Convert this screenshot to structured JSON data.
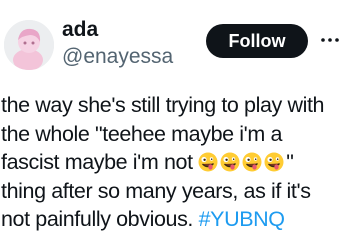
{
  "author": {
    "display_name": "ada",
    "handle": "@enayessa",
    "avatar_icon": "pink-character-avatar-icon"
  },
  "follow_button_label": "Follow",
  "more_icon": "more-horizontal-icon",
  "tweet": {
    "line1": "the way she's still trying to play with",
    "line2": "the whole \"teehee maybe i'm a",
    "line3_text": "fascist maybe i'm not ",
    "line3_emoji": "zany-face-emoji",
    "line3_emoji_count": 4,
    "line3_end": "\"",
    "line4": "thing after so many years, as if it's",
    "line5_text": "not painfully obvious. ",
    "hashtag": "#YUBNQ"
  },
  "colors": {
    "accent": "#1d9bf0",
    "text": "#0f1419",
    "secondary_text": "#536471",
    "follow_button_bg": "#0f1419"
  }
}
